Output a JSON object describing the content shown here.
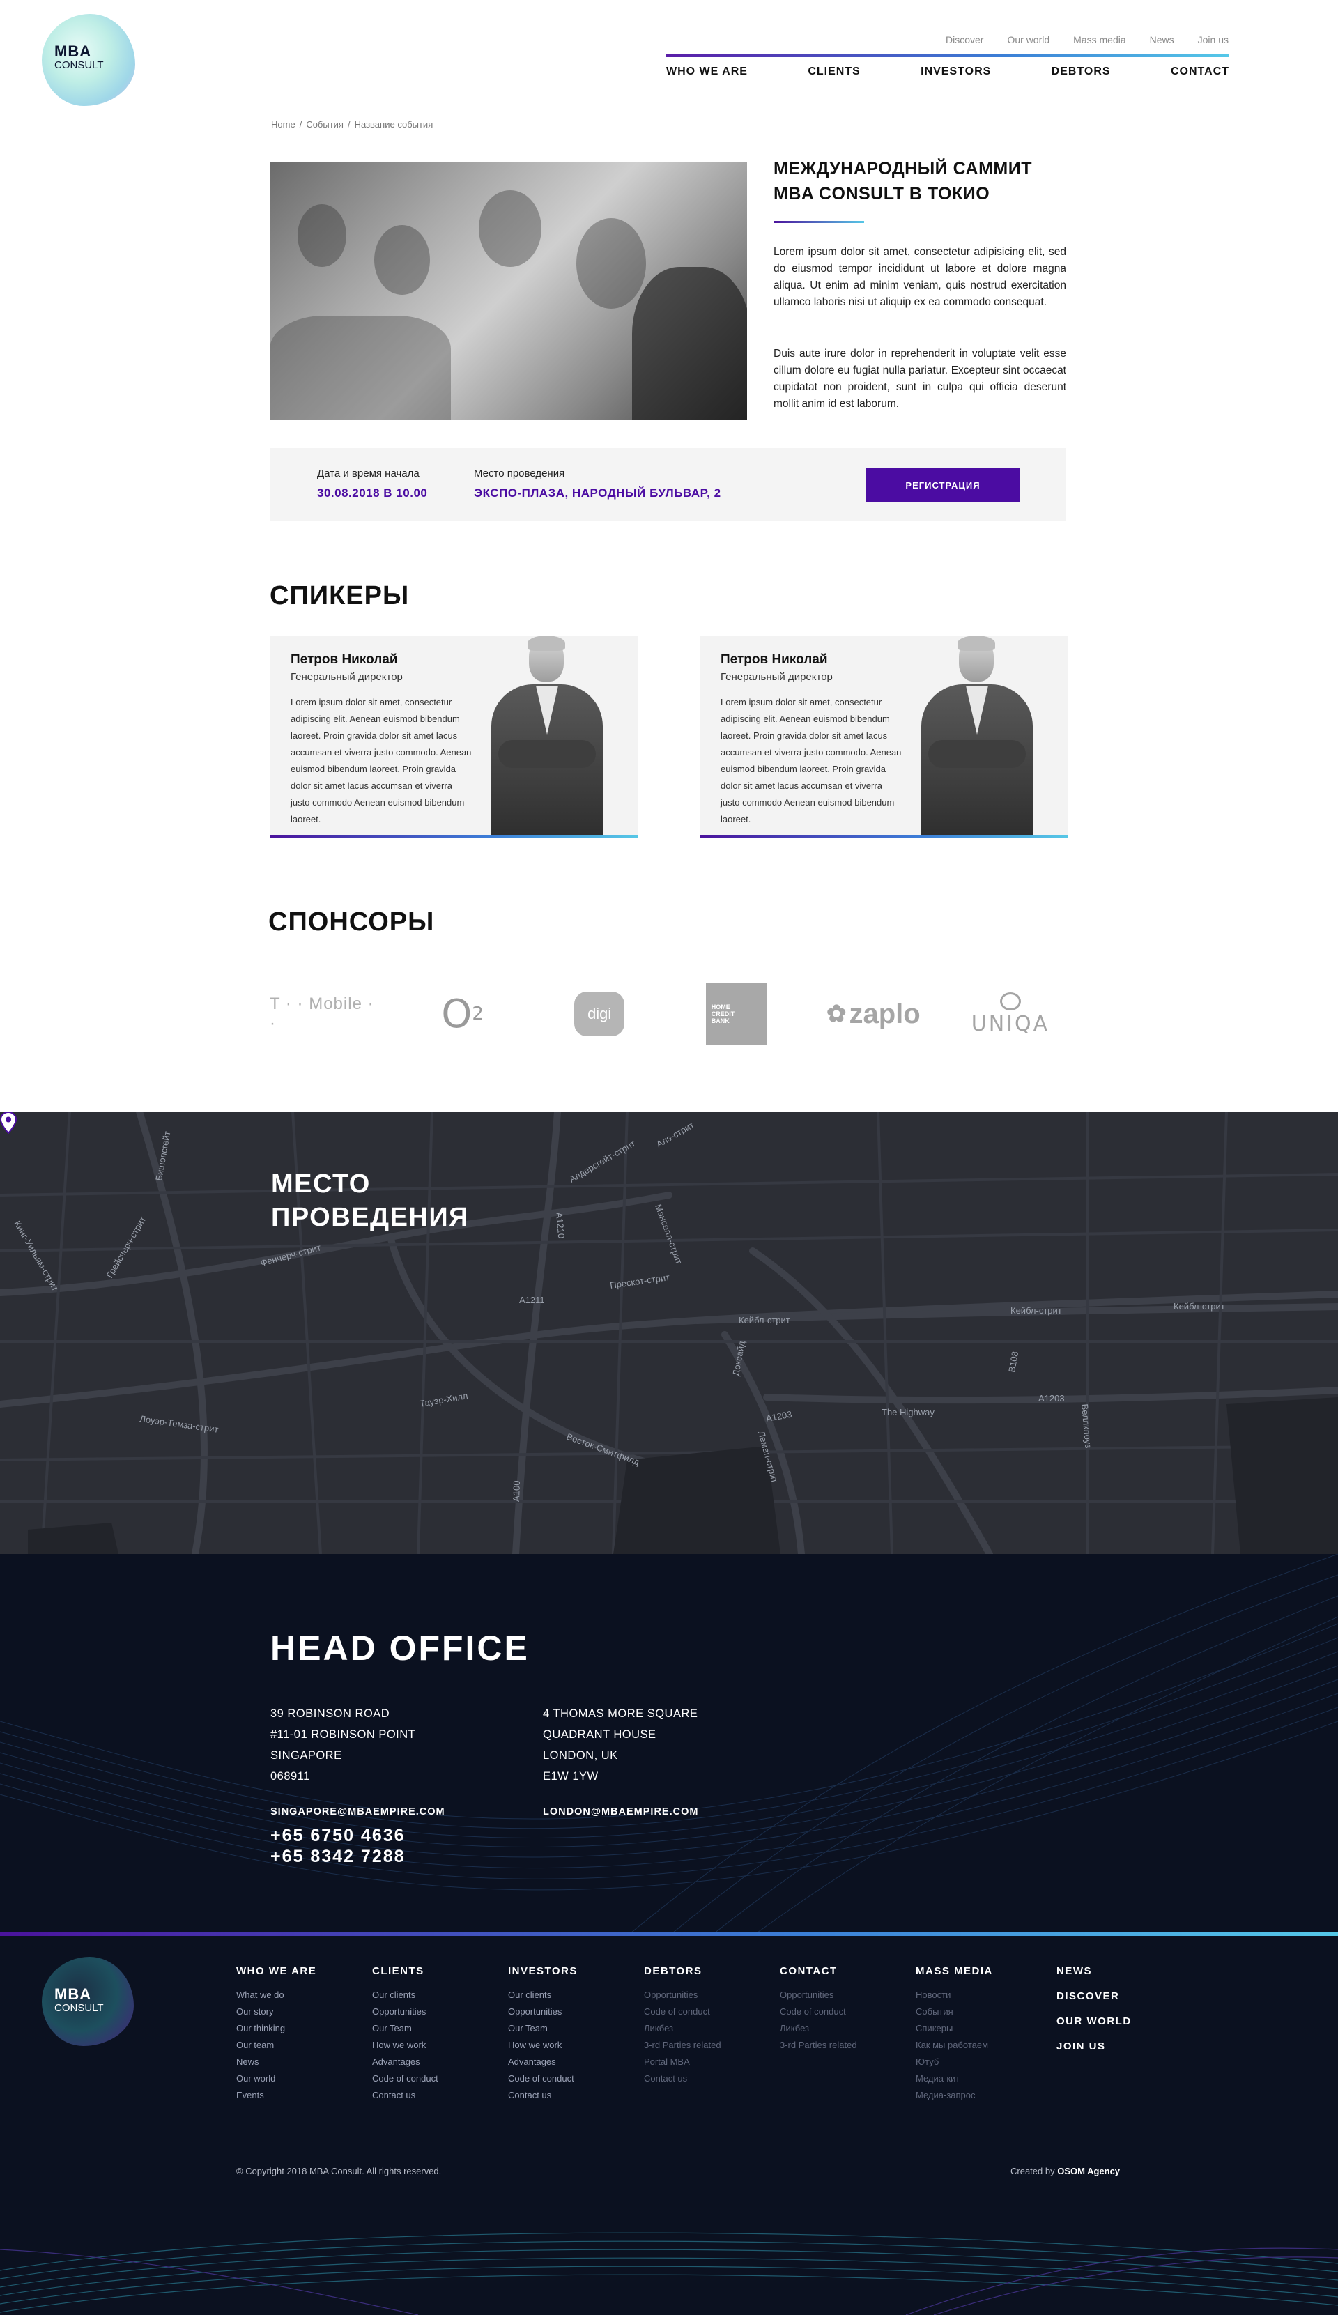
{
  "header": {
    "logo_main": "MBA",
    "logo_sub": "CONSULT",
    "top_links": [
      "Discover",
      "Our world",
      "Mass media",
      "News",
      "Join us"
    ],
    "main_nav": [
      "WHO WE ARE",
      "CLIENTS",
      "INVESTORS",
      "DEBTORS",
      "CONTACT"
    ]
  },
  "breadcrumb": [
    "Home",
    "События",
    "Название события"
  ],
  "event": {
    "title": "МЕЖДУНАРОДНЫЙ САММИТ MBA CONSULT В ТОКИО",
    "para1": "Lorem ipsum dolor sit amet, consectetur adipisicing elit, sed do eiusmod tempor incididunt ut labore et dolore magna aliqua. Ut enim ad minim veniam, quis nostrud exercitation ullamco laboris nisi ut aliquip ex ea commodo consequat.",
    "para2": "Duis aute irure dolor in reprehenderit in voluptate velit esse cillum dolore eu fugiat nulla pariatur. Excepteur sint occaecat cupidatat non proident, sunt in culpa qui officia deserunt mollit anim id est laborum.",
    "date_label": "Дата и время начала",
    "date_value": "30.08.2018 В 10.00",
    "place_label": "Место проведения",
    "place_value": "ЭКСПО-ПЛАЗА, НАРОДНЫЙ БУЛЬВАР, 2",
    "register_label": "РЕГИСТРАЦИЯ"
  },
  "speakers": {
    "title": "СПИКЕРЫ",
    "items": [
      {
        "name": "Петров Николай",
        "role": "Генеральный директор",
        "bio": "Lorem ipsum dolor sit amet, consectetur adipiscing elit. Aenean euismod bibendum laoreet. Proin gravida dolor sit amet lacus accumsan et viverra justo commodo. Aenean euismod bibendum laoreet. Proin gravida dolor sit amet lacus accumsan et viverra justo commodo Aenean euismod bibendum laoreet."
      },
      {
        "name": "Петров Николай",
        "role": "Генеральный директор",
        "bio": "Lorem ipsum dolor sit amet, consectetur adipiscing elit. Aenean euismod bibendum laoreet. Proin gravida dolor sit amet lacus accumsan et viverra justo commodo. Aenean euismod bibendum laoreet. Proin gravida dolor sit amet lacus accumsan et viverra justo commodo Aenean euismod bibendum laoreet."
      }
    ]
  },
  "sponsors": {
    "title": "СПОНСОРЫ",
    "logos": {
      "tmobile": "T · · Mobile · ·",
      "o2_main": "O",
      "o2_sub": "2",
      "digi": "digi",
      "home_credit": [
        "HOME",
        "CREDIT",
        "BANK"
      ],
      "zaplo": "zaplo",
      "uniqa": "UNIQA"
    }
  },
  "map": {
    "title_line1": "МЕСТО",
    "title_line2": "ПРОВЕДЕНИЯ",
    "street_labels": [
      "Алдерсгейт-стрит",
      "Кейбл-стрит",
      "Кейбл-стрит",
      "Кейбл-стрит",
      "Прескот-стрит",
      "A1211",
      "A1203",
      "A1203",
      "The Highway",
      "Тауэр-Хилл",
      "Лоуэр-Темза-стрит",
      "Восток-Смитфилд",
      "Мэнселл-стрит",
      "Леман-стрит",
      "Доксайд",
      "B108",
      "Веллклоуз",
      "A1210",
      "Алэ-стрит",
      "Грейсчерч-стрит",
      "Кинг-Уильям-стрит",
      "Фенчерч-стрит",
      "Бишопсгейт",
      "A100"
    ]
  },
  "office": {
    "title": "HEAD OFFICE",
    "address1": [
      "39 ROBINSON ROAD",
      "#11-01 ROBINSON POINT",
      "SINGAPORE",
      "068911"
    ],
    "address2": [
      "4 THOMAS MORE SQUARE",
      "QUADRANT HOUSE",
      "LONDON, UK",
      "E1W 1YW"
    ],
    "email1": "SINGAPORE@MBAEMPIRE.COM",
    "email2": "LONDON@MBAEMPIRE.COM",
    "phone1": "+65 6750 4636",
    "phone2": "+65 8342 7288"
  },
  "footer": {
    "columns": [
      {
        "title": "WHO WE ARE",
        "items": [
          "What we do",
          "Our story",
          "Our thinking",
          "Our team",
          "News",
          "Our world",
          "Events"
        ]
      },
      {
        "title": "CLIENTS",
        "items": [
          "Our clients",
          "Opportunities",
          "Our Team",
          "How we work",
          "Advantages",
          "Code of conduct",
          "Contact us"
        ]
      },
      {
        "title": "INVESTORS",
        "items": [
          "Our clients",
          "Opportunities",
          "Our Team",
          "How we work",
          "Advantages",
          "Code of conduct",
          "Contact us"
        ]
      },
      {
        "title": "DEBTORS",
        "items": [
          "Opportunities",
          "Code of conduct",
          "Ликбез",
          "3-rd Parties related",
          "Portal MBA",
          "Contact us"
        ]
      },
      {
        "title": "CONTACT",
        "items": [
          "Opportunities",
          "Code of conduct",
          "Ликбез",
          "3-rd Parties related"
        ]
      },
      {
        "title": "MASS MEDIA",
        "items": [
          "Новости",
          "События",
          "Спикеры",
          "Как мы работаем",
          "Ютуб",
          "Медиа-кит",
          "Медиа-запрос"
        ]
      }
    ],
    "side_links": [
      "NEWS",
      "DISCOVER",
      "OUR WORLD",
      "JOIN US"
    ],
    "copyright": "© Copyright 2018 MBA Consult. All rights reserved.",
    "created_prefix": "Created by",
    "created_by": "OSOM Agency"
  },
  "colors": {
    "accent_purple": "#4b0ca2",
    "gradient_end": "#55c8e8",
    "dark_bg": "#0b1120",
    "map_bg": "#2c2e35"
  }
}
